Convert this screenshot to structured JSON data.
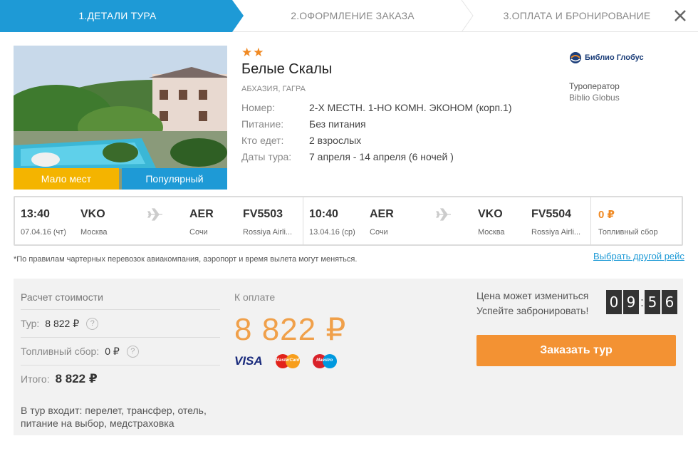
{
  "steps": [
    {
      "label": "1.ДЕТАЛИ ТУРА",
      "active": true
    },
    {
      "label": "2.ОФОРМЛЕНИЕ ЗАКАЗА",
      "active": false
    },
    {
      "label": "3.ОПЛАТА И БРОНИРОВАНИЕ",
      "active": false
    }
  ],
  "colors": {
    "accent": "#1e9ad6",
    "orange": "#f39233",
    "badge_yellow": "#f4b400"
  },
  "hotel": {
    "stars": "★★",
    "name": "Белые Скалы",
    "location": "АБХАЗИЯ, ГАГРА",
    "badges": {
      "few": "Мало мест",
      "popular": "Популярный"
    },
    "props": [
      {
        "k": "Номер:",
        "v": "2-Х МЕСТН. 1-НО КОМН. ЭКОНОМ (корп.1)"
      },
      {
        "k": "Питание:",
        "v": "Без питания"
      },
      {
        "k": "Кто едет:",
        "v": "2 взрослых"
      },
      {
        "k": "Даты тура:",
        "v": "7 апреля - 14 апреля (6 ночей )"
      }
    ]
  },
  "operator": {
    "logo_text": "Библио Глобус",
    "label": "Туроператор",
    "name": "Biblio Globus"
  },
  "flights": [
    {
      "dep_time": "13:40",
      "dep_date": "07.04.16 (чт)",
      "from_code": "VKO",
      "from_city": "Москва",
      "to_code": "AER",
      "to_city": "Сочи",
      "flight_no": "FV5503",
      "airline": "Rossiya Airli..."
    },
    {
      "dep_time": "10:40",
      "dep_date": "13.04.16 (ср)",
      "from_code": "AER",
      "from_city": "Сочи",
      "to_code": "VKO",
      "to_city": "Москва",
      "flight_no": "FV5504",
      "airline": "Rossiya Airli..."
    }
  ],
  "fuel": {
    "amount": "0 ₽",
    "label": "Топливный сбор"
  },
  "note": "*По правилам чартерных перевозок авиакомпания, аэропорт и время вылета могут меняться.",
  "other_flight": "Выбрать другой рейс",
  "calc": {
    "title": "Расчет стоимости",
    "tour_label": "Тур:",
    "tour_value": "8 822 ₽",
    "fuel_label": "Топливный сбор:",
    "fuel_value": "0 ₽",
    "total_label": "Итого:",
    "total_value": "8 822 ₽",
    "includes": "В тур входит: перелет, трансфер, отель, питание на выбор, медстраховка"
  },
  "topay": {
    "label": "К оплате",
    "amount": "8 822 ₽",
    "cards": {
      "visa": "VISA",
      "mastercard": "MasterCard",
      "maestro": "Maestro"
    }
  },
  "price_change": {
    "line1": "Цена может измениться",
    "line2": "Успейте забронировать!"
  },
  "timer": {
    "d1": "0",
    "d2": "9",
    "d3": "5",
    "d4": "6"
  },
  "order_button": "Заказать тур"
}
